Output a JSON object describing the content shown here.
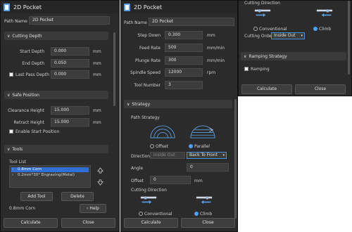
{
  "p1": {
    "title": "2D Pocket",
    "path_name_label": "Path Name",
    "path_name_value": "2D Pocket",
    "cutting_depth": {
      "header": "Cutting Depth",
      "start_label": "Start Depth",
      "start_value": "0.000",
      "end_label": "End Depth",
      "end_value": "0.050",
      "last_label": "Last Pass Depth",
      "last_value": "0.000",
      "unit": "mm"
    },
    "safe_position": {
      "header": "Safe Position",
      "clear_label": "Clearance Height",
      "clear_value": "15.000",
      "retract_label": "Retract Height",
      "retract_value": "15.000",
      "unit": "mm",
      "enable_start_label": "Enable Start Position"
    },
    "tools": {
      "header": "Tools",
      "list_label": "Tool List",
      "items": [
        "0.8mm Corn",
        "0.2mm*30° Engraving(Metal)"
      ],
      "add_label": "Add Tool",
      "delete_label": "Delete",
      "selected_tool": "0.8mm Corn",
      "help_label": "Help"
    },
    "calculate_label": "Calculate",
    "close_label": "Close"
  },
  "p2": {
    "title": "2D Pocket",
    "path_name_label": "Path Name",
    "path_name_value": "2D Pocket",
    "step_down_label": "Step Down",
    "step_down_value": "0.300",
    "step_down_unit": "mm",
    "feed_label": "Feed Rate",
    "feed_value": "500",
    "feed_unit": "mm/min",
    "plunge_label": "Plunge Rate",
    "plunge_value": "300",
    "plunge_unit": "mm/min",
    "spindle_label": "Spindle Speed",
    "spindle_value": "12000",
    "spindle_unit": "rpm",
    "tool_number_label": "Tool Number",
    "tool_number_value": "3",
    "strategy": {
      "header": "Strategy",
      "path_strategy_label": "Path Strategy",
      "offset_label": "Offset",
      "parallel_label": "Parallel",
      "direction_label": "Direction",
      "direction_value": "Inside Out",
      "direction_select": "Back To Front",
      "angle_label": "Angle",
      "angle_value": "0",
      "offset_field_label": "Offset",
      "offset_value": "0",
      "offset_unit": "mm",
      "cutting_direction_label": "Cutting Direction",
      "conventional_label": "Conventional",
      "climb_label": "Climb"
    },
    "calculate_label": "Calculate",
    "close_label": "Close"
  },
  "p3": {
    "cutting_direction_label": "Cutting Direction",
    "conventional_label": "Conventional",
    "climb_label": "Climb",
    "cutting_order_label": "Cutting Order",
    "cutting_order_value": "Inside Out",
    "ramping_header": "Ramping Strategy",
    "ramping_label": "Ramping",
    "calculate_label": "Calculate",
    "close_label": "Close"
  }
}
